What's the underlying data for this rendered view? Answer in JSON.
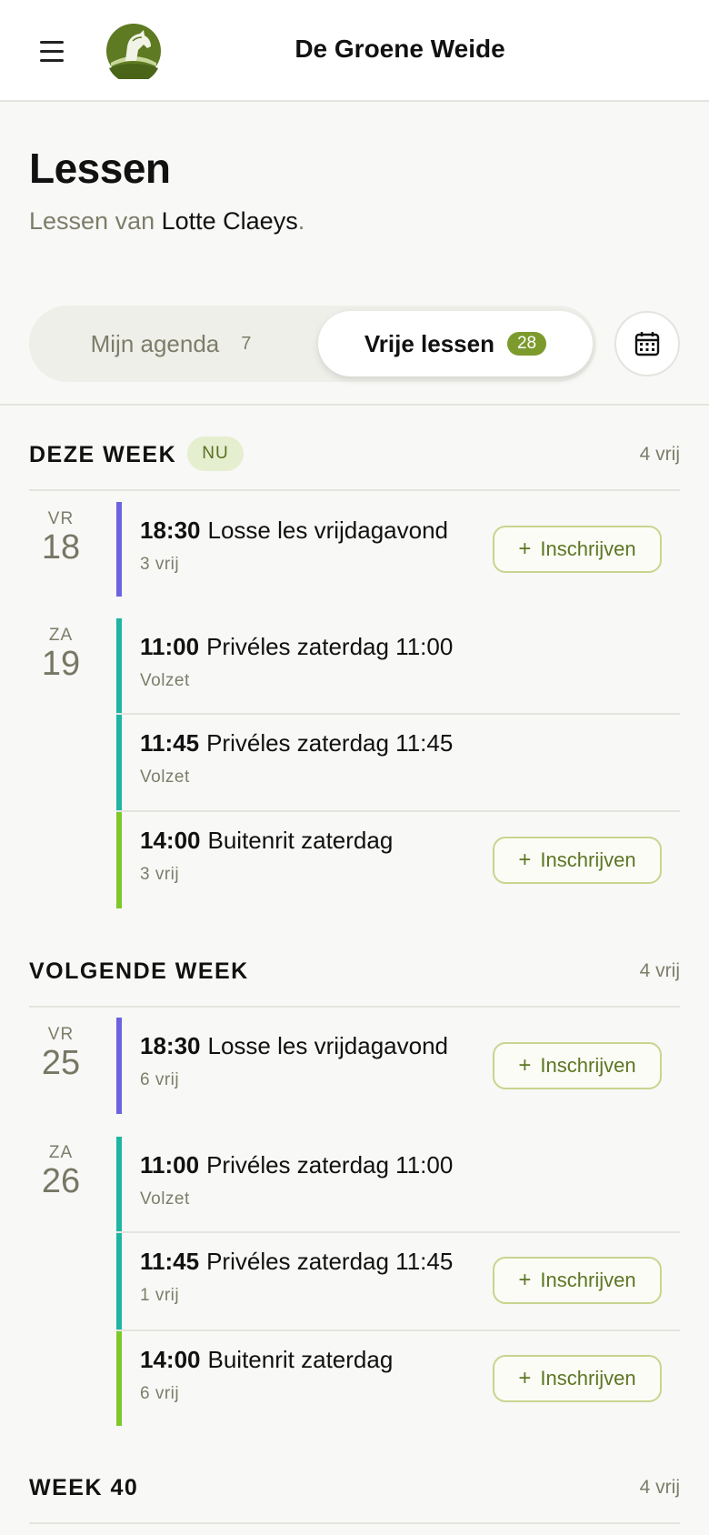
{
  "app": {
    "title": "De Groene Weide",
    "menu_icon": "hamburger-menu-icon",
    "logo": "horse-logo"
  },
  "page": {
    "title": "Lessen",
    "subtitle_prefix": "Lessen van ",
    "subtitle_name": "Lotte Claeys",
    "subtitle_suffix": "."
  },
  "tabs": {
    "agenda": {
      "label": "Mijn agenda",
      "count": "7"
    },
    "free": {
      "label": "Vrije lessen",
      "count": "28"
    },
    "calendar_icon": "calendar-icon"
  },
  "colors": {
    "accent": "#7d9a2d",
    "purple": "#6c63e0",
    "teal": "#1fb5a3",
    "lime": "#7ec82a"
  },
  "enroll_label": "Inschrijven",
  "weeks": [
    {
      "title": "DEZE WEEK",
      "badge": "NU",
      "count": "4 vrij",
      "days": [
        {
          "dow": "VR",
          "num": "18",
          "lessons": [
            {
              "time": "18:30",
              "name": "Losse les vrijdagavond",
              "status": "3 vrij",
              "enroll": true
            }
          ]
        },
        {
          "dow": "ZA",
          "num": "19",
          "lessons": [
            {
              "time": "11:00",
              "name": "Privéles zaterdag 11:00",
              "status": "Volzet",
              "enroll": false
            },
            {
              "time": "11:45",
              "name": "Privéles zaterdag 11:45",
              "status": "Volzet",
              "enroll": false
            },
            {
              "time": "14:00",
              "name": "Buitenrit zaterdag",
              "status": "3 vrij",
              "enroll": true
            }
          ]
        }
      ]
    },
    {
      "title": "VOLGENDE WEEK",
      "count": "4 vrij",
      "days": [
        {
          "dow": "VR",
          "num": "25",
          "lessons": [
            {
              "time": "18:30",
              "name": "Losse les vrijdagavond",
              "status": "6 vrij",
              "enroll": true
            }
          ]
        },
        {
          "dow": "ZA",
          "num": "26",
          "lessons": [
            {
              "time": "11:00",
              "name": "Privéles zaterdag 11:00",
              "status": "Volzet",
              "enroll": false
            },
            {
              "time": "11:45",
              "name": "Privéles zaterdag 11:45",
              "status": "1 vrij",
              "enroll": true
            },
            {
              "time": "14:00",
              "name": "Buitenrit zaterdag",
              "status": "6 vrij",
              "enroll": true
            }
          ]
        }
      ]
    },
    {
      "title": "WEEK 40",
      "count": "4 vrij"
    }
  ]
}
